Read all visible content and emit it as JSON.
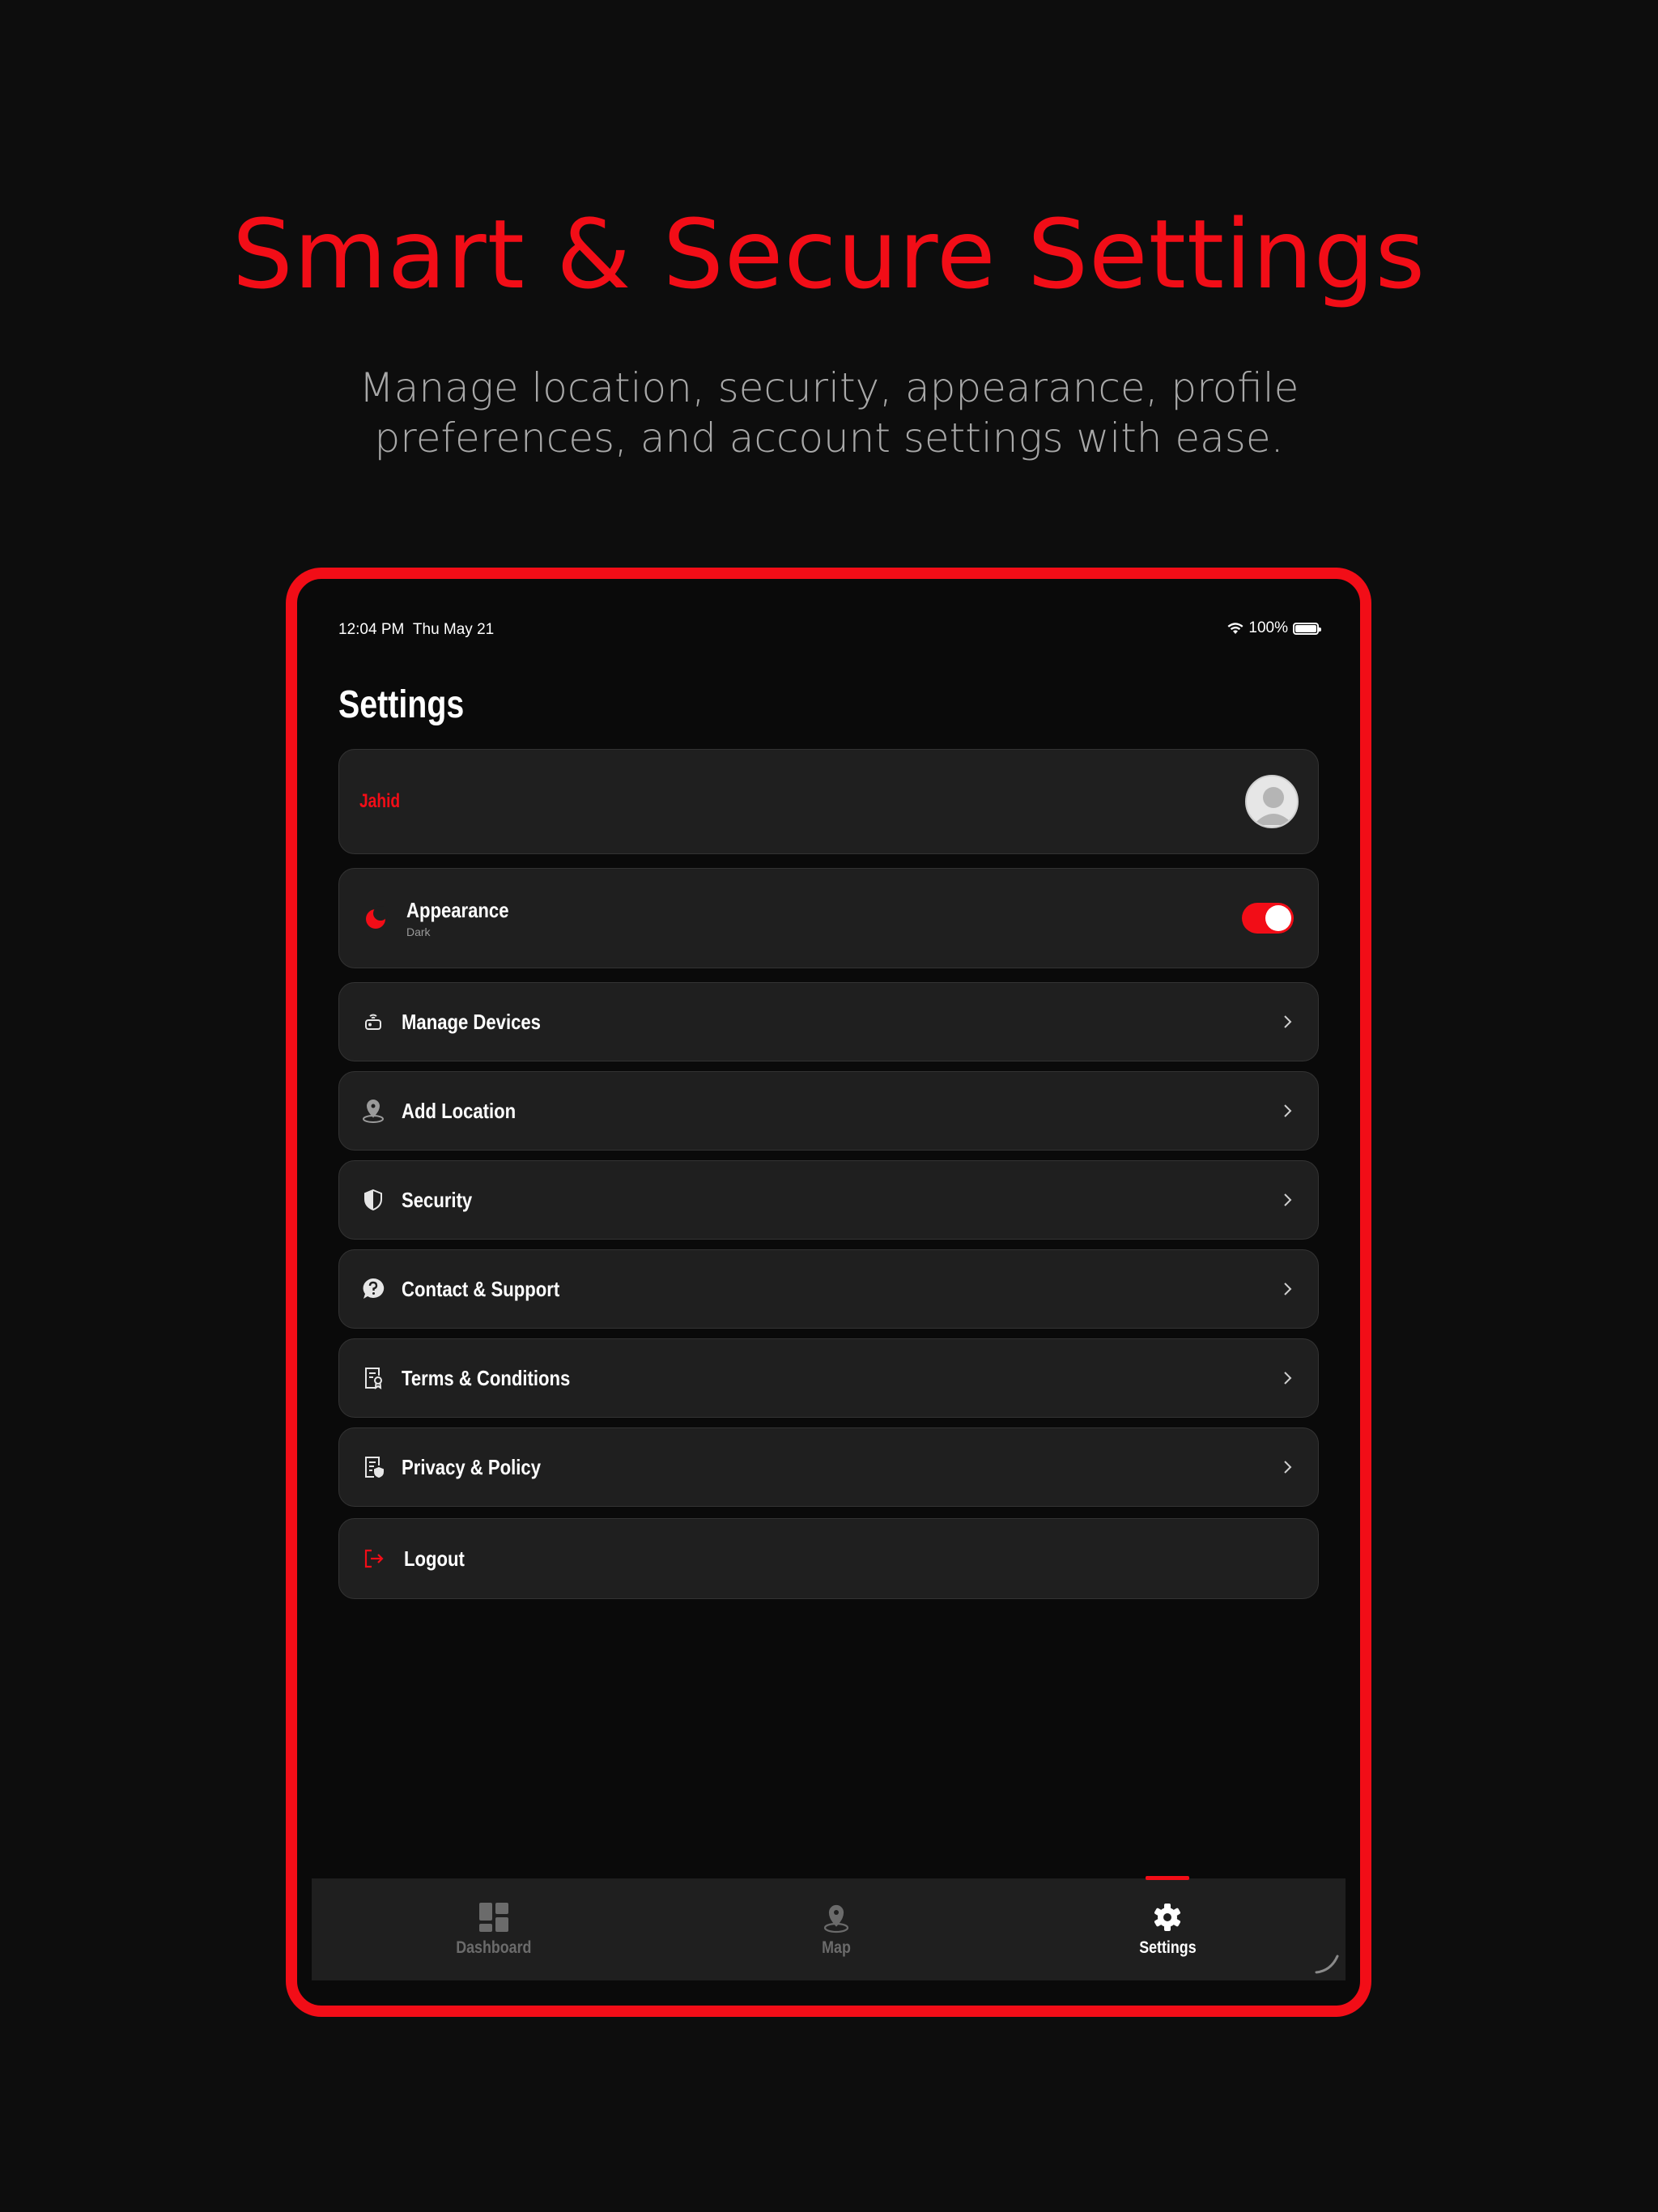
{
  "hero": {
    "title": "Smart & Secure Settings",
    "subtitle": "Manage location, security, appearance, profile preferences, and account settings with ease."
  },
  "status_bar": {
    "time": "12:04 PM",
    "date": "Thu May 21",
    "battery": "100%"
  },
  "page": {
    "title": "Settings"
  },
  "profile": {
    "name": "Jahid"
  },
  "appearance": {
    "label": "Appearance",
    "value": "Dark",
    "toggle_on": true
  },
  "menu": [
    {
      "label": "Manage Devices",
      "icon": "router-icon"
    },
    {
      "label": "Add Location",
      "icon": "location-pin-icon"
    },
    {
      "label": "Security",
      "icon": "shield-icon"
    },
    {
      "label": "Contact & Support",
      "icon": "help-chat-icon"
    },
    {
      "label": "Terms & Conditions",
      "icon": "certificate-document-icon"
    },
    {
      "label": "Privacy & Policy",
      "icon": "privacy-document-icon"
    }
  ],
  "logout": {
    "label": "Logout"
  },
  "tabs": [
    {
      "label": "Dashboard",
      "active": false
    },
    {
      "label": "Map",
      "active": false
    },
    {
      "label": "Settings",
      "active": true
    }
  ],
  "colors": {
    "accent": "#f20d17",
    "background": "#0d0d0d",
    "card": "#1f1f1f",
    "muted": "#a8a8a8"
  }
}
